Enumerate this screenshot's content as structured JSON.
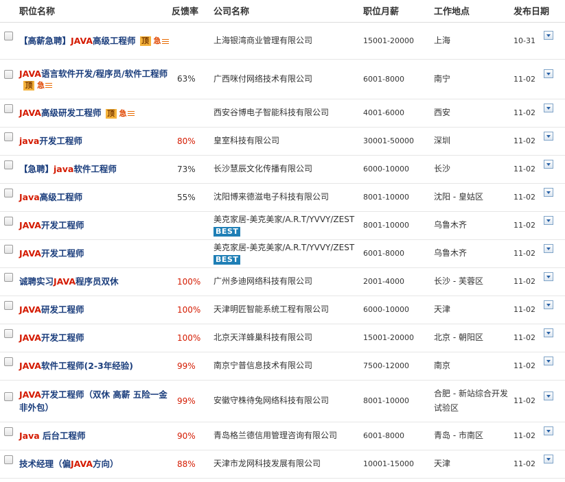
{
  "headers": {
    "title": "职位名称",
    "rate": "反馈率",
    "company": "公司名称",
    "salary": "职位月薪",
    "location": "工作地点",
    "date": "发布日期"
  },
  "badges": {
    "top": "顶",
    "urgent": "急"
  },
  "colors": {
    "title_blue": "#1a3d7c",
    "keyword_red": "#d41a00",
    "best_badge": "#1f7fb6",
    "top_badge": "#f4b23b"
  },
  "rows": [
    {
      "t1": "【高薪急聘】",
      "kw": "JAVA",
      "t2": "高级工程师",
      "rate": "",
      "company": "上海银湾商业管理有限公司",
      "best": "",
      "salary": "15001-20000",
      "loc": "上海",
      "date": "10-31"
    },
    {
      "t1": "",
      "kw": "JAVA",
      "t2": "语言软件开发/程序员/软件工程师",
      "rate": "63%",
      "company": "广西咪付网络技术有限公司",
      "best": "",
      "salary": "6001-8000",
      "loc": "南宁",
      "date": "11-02"
    },
    {
      "t1": "",
      "kw": "JAVA",
      "t2": "高级研发工程师",
      "rate": "",
      "company": "西安谷博电子智能科技有限公司",
      "best": "",
      "salary": "4001-6000",
      "loc": "西安",
      "date": "11-02"
    },
    {
      "t1": "",
      "kw": "java",
      "t2": "开发工程师",
      "rate": "80%",
      "company": "皇室科技有限公司",
      "best": "",
      "salary": "30001-50000",
      "loc": "深圳",
      "date": "11-02"
    },
    {
      "t1": "【急聘】",
      "kw": "java",
      "t2": "软件工程师",
      "rate": "73%",
      "company": "长沙慧辰文化传播有限公司",
      "best": "",
      "salary": "6000-10000",
      "loc": "长沙",
      "date": "11-02"
    },
    {
      "t1": "",
      "kw": "Java",
      "t2": "高级工程师",
      "rate": "55%",
      "company": "沈阳博来德滋电子科技有限公司",
      "best": "",
      "salary": "8001-10000",
      "loc": "沈阳 - 皇姑区",
      "date": "11-02"
    },
    {
      "t1": "",
      "kw": "JAVA",
      "t2": "开发工程师",
      "rate": "",
      "company": "美克家居-美克美家/A.R.T/YVVY/ZEST",
      "best": "BEST",
      "salary": "8001-10000",
      "loc": "乌鲁木齐",
      "date": "11-02"
    },
    {
      "t1": "",
      "kw": "JAVA",
      "t2": "开发工程师",
      "rate": "",
      "company": "美克家居-美克美家/A.R.T/YVVY/ZEST",
      "best": "BEST",
      "salary": "6001-8000",
      "loc": "乌鲁木齐",
      "date": "11-02"
    },
    {
      "t1": "诚聘实习",
      "kw": "JAVA",
      "t2": "程序员双休",
      "rate": "100%",
      "company": "广州多迪网络科技有限公司",
      "best": "",
      "salary": "2001-4000",
      "loc": "长沙 - 芙蓉区",
      "date": "11-02"
    },
    {
      "t1": "",
      "kw": "JAVA",
      "t2": "研发工程师",
      "rate": "100%",
      "company": "天津明匠智能系统工程有限公司",
      "best": "",
      "salary": "6000-10000",
      "loc": "天津",
      "date": "11-02"
    },
    {
      "t1": "",
      "kw": "JAVA",
      "t2": "开发工程师",
      "rate": "100%",
      "company": "北京天洋蜂巢科技有限公司",
      "best": "",
      "salary": "15001-20000",
      "loc": "北京 - 朝阳区",
      "date": "11-02"
    },
    {
      "t1": "",
      "kw": "JAVA",
      "t2": "软件工程师(2-3年经验)",
      "rate": "99%",
      "company": "南京宁普信息技术有限公司",
      "best": "",
      "salary": "7500-12000",
      "loc": "南京",
      "date": "11-02"
    },
    {
      "t1": "",
      "kw": "JAVA",
      "t2": "开发工程师（双休 高薪 五险一金 非外包）",
      "rate": "99%",
      "company": "安徽守株待兔网络科技有限公司",
      "best": "",
      "salary": "8001-10000",
      "loc": "合肥 - 新站综合开发试验区",
      "date": "11-02"
    },
    {
      "t1": "",
      "kw": "Java",
      "t2": " 后台工程师",
      "rate": "90%",
      "company": "青岛格兰德信用管理咨询有限公司",
      "best": "",
      "salary": "6001-8000",
      "loc": "青岛 - 市南区",
      "date": "11-02"
    },
    {
      "t1": "技术经理（偏",
      "kw": "JAVA",
      "t2": "方向）",
      "rate": "88%",
      "company": "天津市龙网科技发展有限公司",
      "best": "",
      "salary": "10001-15000",
      "loc": "天津",
      "date": "11-02"
    }
  ]
}
